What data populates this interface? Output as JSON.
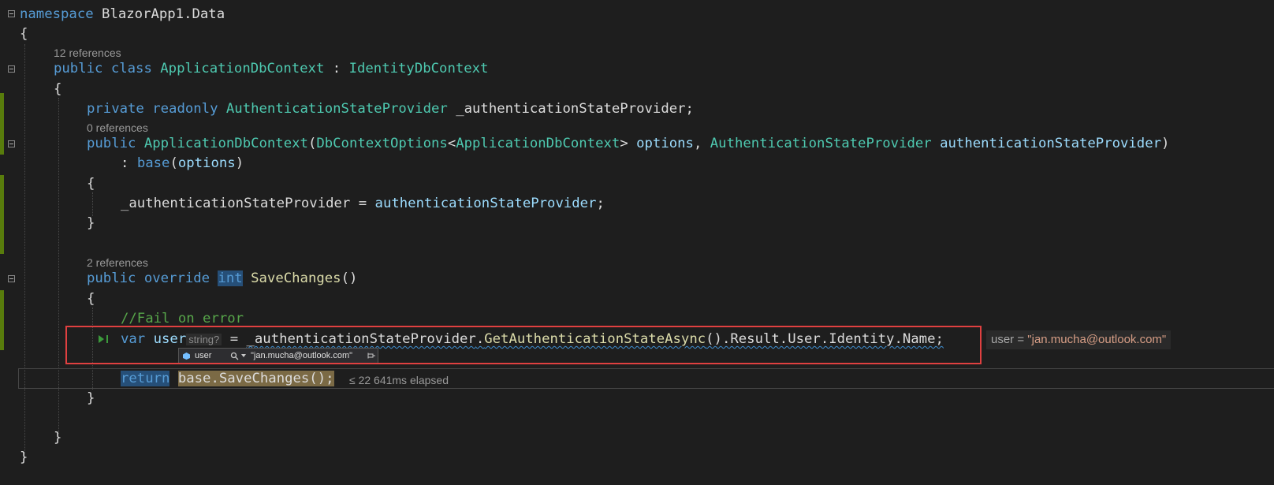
{
  "lines": {
    "l1": [
      "namespace",
      "BlazorApp1.Data"
    ],
    "l2": "{",
    "l3_lens": "12 references",
    "l3": [
      "public",
      "class",
      "ApplicationDbContext",
      ":",
      "IdentityDbContext"
    ],
    "l4": "{",
    "l5": [
      "private",
      "readonly",
      "AuthenticationStateProvider",
      "_authenticationStateProvider;"
    ],
    "l6_lens": "0 references",
    "l6": [
      "public",
      "ApplicationDbContext",
      "(",
      "DbContextOptions",
      "<",
      "ApplicationDbContext",
      ">",
      "options",
      ", ",
      "AuthenticationStateProvider",
      "authenticationStateProvider",
      ")"
    ],
    "l7": [
      ": ",
      "base",
      "(",
      "options",
      ")"
    ],
    "l8": "{",
    "l9": [
      "_authenticationStateProvider",
      " = ",
      "authenticationStateProvider",
      ";"
    ],
    "l10": "}",
    "l11_lens": "2 references",
    "l11": [
      "public",
      "override",
      "int",
      "SaveChanges",
      "()"
    ],
    "l12": "{",
    "l13": "//Fail on error",
    "l14": [
      "var",
      "user",
      "string?",
      "= ",
      "_authenticationStateProvider",
      ".",
      "GetAuthenticationStateAsync",
      "()",
      ".Result.User.Identity.Name;"
    ],
    "l14_ghost": {
      "name": "user = ",
      "value": "\"jan.mucha@outlook.com\""
    },
    "l15": [
      "return",
      "base.SaveChanges();"
    ],
    "l15_elapsed": "≤ 22 641ms elapsed",
    "l16": "}",
    "l17": "}",
    "l18": "}"
  },
  "datatip": {
    "name": "user",
    "value": "\"jan.mucha@outlook.com\""
  },
  "colors": {
    "keyword": "#569cd6",
    "type": "#4ec9b0",
    "method": "#dcdcaa",
    "param": "#9cdcfe",
    "comment": "#57a64a",
    "string": "#d69d85",
    "highlight": "#e04040",
    "change_bar": "#587c0c"
  },
  "icons": [
    "fold-toggle-icon",
    "run-to-click-icon",
    "object-icon",
    "magnifier-icon",
    "chevron-down-icon",
    "pin-icon"
  ]
}
